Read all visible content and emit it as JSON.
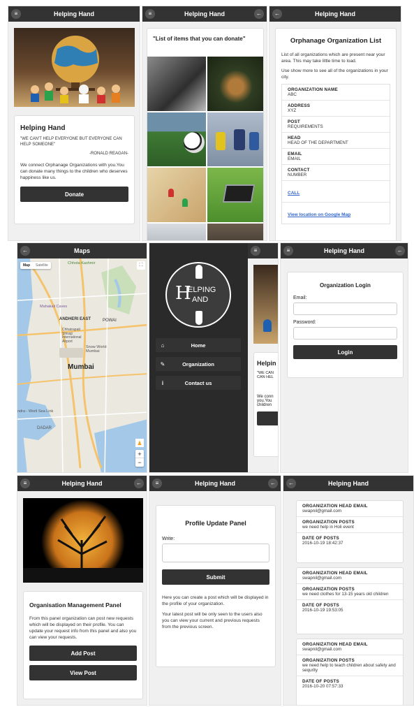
{
  "app_title": "Helping Hand",
  "maps_title": "Maps",
  "home": {
    "card_title": "Helping Hand",
    "quote": "\"WE CAN'T HELP EVERYONE BUT EVERYONE CAN HELP SOMEONE\"",
    "quote_author": "-RONALD REAGAN-",
    "description": "We connect Orphanage Organizations with you.You can donate many things to the children who deserves happiness like us.",
    "donate_label": "Donate"
  },
  "donate_list": {
    "title": "\"List of items that you can donate\""
  },
  "orgs": {
    "title": "Orphanage Organization List",
    "intro": "List of all organizations which are present near your area. This may take little time to load.",
    "intro2": "Use show more to see all of the organizations in your city.",
    "fields": [
      {
        "label": "ORGANIZATION NAME",
        "value": "ABC"
      },
      {
        "label": "ADDRESS",
        "value": "XYZ"
      },
      {
        "label": "POST",
        "value": "REQUIREMENTS"
      },
      {
        "label": "HEAD",
        "value": "HEAD OF THE DEPARTMENT"
      },
      {
        "label": "EMAIL",
        "value": "EMAIL"
      },
      {
        "label": "CONTACT",
        "value": "NUMBER"
      }
    ],
    "call_label": "CALL",
    "map_link_label": "View location on Google Map"
  },
  "map": {
    "type_map": "Map",
    "type_satellite": "Satellite",
    "labels": {
      "chhota_kashmir": "Chhota Kashmir",
      "mahakali": "Mahakali Caves",
      "andheri": "ANDHERI EAST",
      "powai": "POWAI",
      "airport": "Chhatrapati Shivaji International Airport",
      "snow": "Snow World Mumbai",
      "mumbai": "Mumbai",
      "worli": "ndra - Worli Sea Link",
      "dadar": "DADAR"
    },
    "zoom_in": "+",
    "zoom_out": "−"
  },
  "drawer": {
    "logo_line1": "ELPING",
    "logo_line2": "AND",
    "logo_h1": "H",
    "logo_h2": "H",
    "items": [
      {
        "icon": "⌂",
        "label": "Home"
      },
      {
        "icon": "✎",
        "label": "Organization"
      },
      {
        "icon": "i",
        "label": "Contact us"
      }
    ],
    "peek_title": "Helpin",
    "peek_quote1": "\"WE CAN",
    "peek_quote2": "CAN HEL",
    "peek_desc1": "We conn",
    "peek_desc2": "you.You",
    "peek_desc3": "children"
  },
  "login": {
    "title": "Organization Login",
    "email_label": "Email:",
    "password_label": "Password:",
    "login_label": "Login"
  },
  "mgmt": {
    "title": "Organisation Management Panel",
    "desc": "From this panel organization can post new requests which will be displayed on their profile. You can update your request info from this panel and also you can view your requests.",
    "add_label": "Add Post",
    "view_label": "View Post"
  },
  "profile": {
    "title": "Profile Update Panel",
    "write_label": "Write:",
    "submit_label": "Submit",
    "desc1": "Here you can create a post which will be displayed in the profile of your organization.",
    "desc2": "Your latest post will be only seen to the users also you can view your current and previous requests from the previous screen."
  },
  "posts": {
    "email_label": "ORGANIZATION HEAD EMAIL",
    "posts_label": "ORGANIZATION POSTS",
    "date_label": "DATE OF POSTS",
    "items": [
      {
        "email": "swapnil@gmail.com",
        "post": "we need help in Holi event",
        "date": "2016-10-19 18:42:37"
      },
      {
        "email": "swapnil@gmail.com",
        "post": "we need clothes for 13-15 years old children",
        "date": "2016-10-19 19:53:05"
      },
      {
        "email": "swapnil@gmail.com",
        "post": "we need help to teach children about safety and sequrity",
        "date": "2016-10-20 07:57:33"
      }
    ]
  },
  "colors": {
    "header": "#333333",
    "button": "#333333",
    "link": "#3366cc",
    "drawer": "#222222"
  },
  "icons": {
    "menu": "menu-icon",
    "back": "back-arrow-icon"
  }
}
